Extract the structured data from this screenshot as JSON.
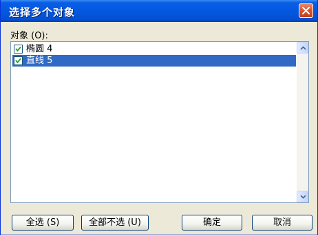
{
  "dialog": {
    "title": "选择多个对象"
  },
  "list": {
    "label": "对象 (O):",
    "items": [
      {
        "label": "椭圆 4",
        "checked": true,
        "selected": false
      },
      {
        "label": "直线 5",
        "checked": true,
        "selected": true
      }
    ]
  },
  "buttons": {
    "select_all": "全选 (S)",
    "deselect_all": "全部不选 (U)",
    "ok": "确定",
    "cancel": "取消"
  },
  "colors": {
    "titlebar": "#0458e0",
    "selection": "#316ac5",
    "close": "#d9522d"
  },
  "icons": {
    "close": "close-icon",
    "scroll_up": "chevron-up-icon",
    "scroll_down": "chevron-down-icon",
    "checkbox": "check-icon"
  }
}
